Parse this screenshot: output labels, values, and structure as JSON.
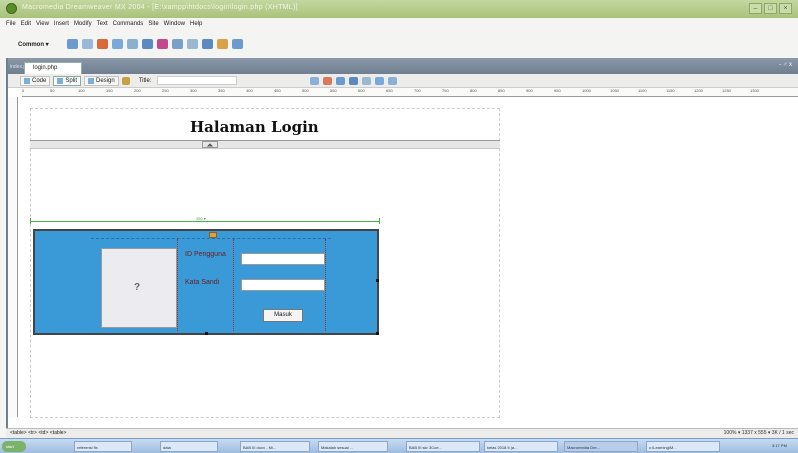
{
  "window": {
    "title": "Macromedia Dreamweaver MX 2004 - [E:\\xampp\\htdocs\\login\\login.php (XHTML)]"
  },
  "menubar": {
    "items": [
      "File",
      "Edit",
      "View",
      "Insert",
      "Modify",
      "Text",
      "Commands",
      "Site",
      "Window",
      "Help"
    ]
  },
  "insertbar": {
    "category": "Common ▾"
  },
  "document": {
    "tab_inactive": "index.php",
    "tab_active": "login.php",
    "controls": "- ♂ x",
    "toolbar": {
      "code_label": "Code",
      "split_label": "Split",
      "design_label": "Design",
      "title_label": "Title:"
    },
    "ruler_ticks": [
      "0",
      "50",
      "100",
      "150",
      "200",
      "250",
      "300",
      "350",
      "400",
      "450",
      "500",
      "550",
      "600",
      "650",
      "700",
      "750",
      "800",
      "850",
      "900",
      "950",
      "1000",
      "1050",
      "1100",
      "1150",
      "1200",
      "1250",
      "1300"
    ],
    "page_title": "Halaman Login",
    "guide_label": "350 ▾",
    "form": {
      "id_label": "ID Pengguna",
      "password_label": "Kata Sandi",
      "submit_label": "Masuk",
      "id_value": "",
      "password_value": ""
    }
  },
  "statusbar": {
    "tag_selector": "<table> <tr> <td> <table>",
    "right": "100% ▾  1337 x 555 ▾  3K / 1 sec"
  },
  "taskbar": {
    "start_label": "start",
    "items": [
      "referensi fix",
      "data",
      "BAB III docx - Mi...",
      "Makalah sesuai ...",
      "BAB III skr 3Coe...",
      "kelas 2018 ti (a...",
      "Macromedia Dre...",
      "c:\\Learning\\M..."
    ],
    "tray": "3:17 PM"
  },
  "colors": {
    "titlebar": "#a9c27a",
    "table_bg": "#3a9ad8",
    "label_text": "#6a2020",
    "guide": "#48b048"
  }
}
